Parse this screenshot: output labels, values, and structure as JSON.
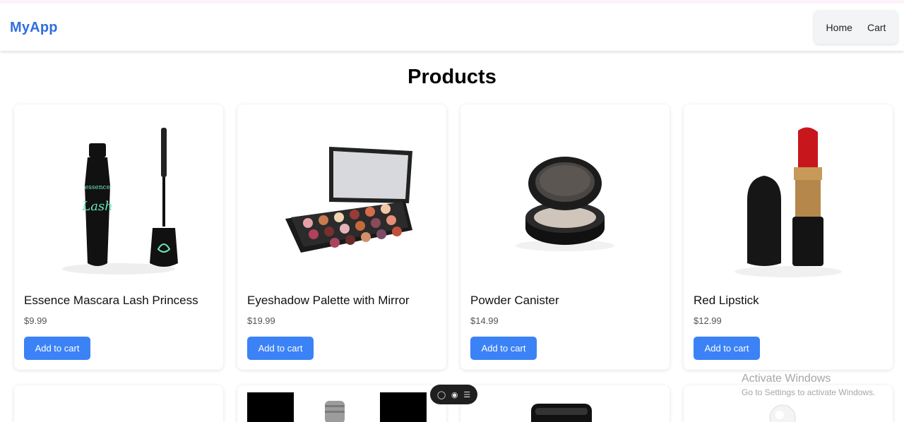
{
  "app": {
    "brand": "MyApp"
  },
  "nav": {
    "home": "Home",
    "cart": "Cart"
  },
  "page": {
    "title": "Products"
  },
  "products": [
    {
      "title": "Essence Mascara Lash Princess",
      "price": "$9.99",
      "button": "Add to cart"
    },
    {
      "title": "Eyeshadow Palette with Mirror",
      "price": "$19.99",
      "button": "Add to cart"
    },
    {
      "title": "Powder Canister",
      "price": "$14.99",
      "button": "Add to cart"
    },
    {
      "title": "Red Lipstick",
      "price": "$12.99",
      "button": "Add to cart"
    }
  ],
  "watermark": {
    "line1": "Activate Windows",
    "line2": "Go to Settings to activate Windows."
  },
  "colors": {
    "brand": "#2f6fe0",
    "button": "#3b82f6"
  }
}
